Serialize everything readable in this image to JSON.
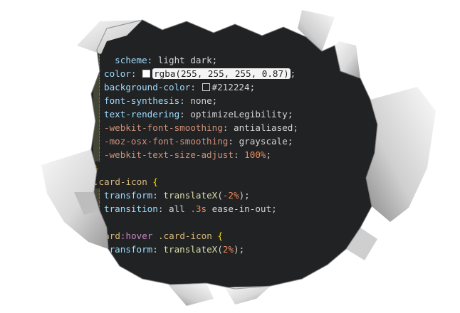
{
  "colors": {
    "editor_bg": "#212224",
    "paper": "#ffffff",
    "property": "#9cdcfe",
    "value": "#d4d4d4",
    "punct": "#d4d4d4",
    "number": "#b5cea8",
    "unit": "#f08a5d",
    "selector": "#d7ba7d",
    "func": "#dcdcaa",
    "keyword": "#569cd6",
    "pseudo": "#c586c0",
    "brace": "#ffd700",
    "vendor": "#ce9178"
  },
  "code": [
    {
      "indent": 1,
      "tokens": [
        {
          "t": "  scheme",
          "c": "property"
        },
        {
          "t": ": ",
          "c": "punct"
        },
        {
          "t": "light dark",
          "c": "value"
        },
        {
          "t": ";",
          "c": "punct"
        }
      ]
    },
    {
      "indent": 1,
      "tokens": [
        {
          "t": "color",
          "c": "property"
        },
        {
          "t": ": ",
          "c": "punct"
        },
        {
          "t": "",
          "c": "swatch",
          "swatch": "#ffffff"
        },
        {
          "t": "rgba(255, 255, 255, 0.87)",
          "c": "highlight"
        },
        {
          "t": ";",
          "c": "punct"
        }
      ]
    },
    {
      "indent": 1,
      "tokens": [
        {
          "t": "background-color",
          "c": "property"
        },
        {
          "t": ": ",
          "c": "punct"
        },
        {
          "t": "",
          "c": "swatch",
          "swatch": "#212224"
        },
        {
          "t": "#212224",
          "c": "value"
        },
        {
          "t": ";",
          "c": "punct"
        }
      ]
    },
    {
      "indent": 1,
      "tokens": [
        {
          "t": "font-synthesis",
          "c": "property"
        },
        {
          "t": ": ",
          "c": "punct"
        },
        {
          "t": "none",
          "c": "value"
        },
        {
          "t": ";",
          "c": "punct"
        }
      ]
    },
    {
      "indent": 1,
      "tokens": [
        {
          "t": "text-rendering",
          "c": "property"
        },
        {
          "t": ": ",
          "c": "punct"
        },
        {
          "t": "optimizeLegibility",
          "c": "value"
        },
        {
          "t": ";",
          "c": "punct"
        }
      ]
    },
    {
      "indent": 1,
      "tokens": [
        {
          "t": "-webkit-font-smoothing",
          "c": "vendor"
        },
        {
          "t": ": ",
          "c": "punct"
        },
        {
          "t": "antialiased",
          "c": "value"
        },
        {
          "t": ";",
          "c": "punct"
        }
      ]
    },
    {
      "indent": 1,
      "tokens": [
        {
          "t": "-moz-osx-font-smoothing",
          "c": "vendor"
        },
        {
          "t": ": ",
          "c": "punct"
        },
        {
          "t": "grayscale",
          "c": "value"
        },
        {
          "t": ";",
          "c": "punct"
        }
      ]
    },
    {
      "indent": 1,
      "tokens": [
        {
          "t": "-webkit-text-size-adjust",
          "c": "vendor"
        },
        {
          "t": ": ",
          "c": "punct"
        },
        {
          "t": "100%",
          "c": "unit"
        },
        {
          "t": ";",
          "c": "punct"
        }
      ]
    },
    {
      "indent": 0,
      "tokens": [
        {
          "t": "}",
          "c": "brace"
        }
      ]
    },
    {
      "indent": 0,
      "tokens": [
        {
          "t": ".card-icon",
          "c": "selector"
        },
        {
          "t": " ",
          "c": "punct"
        },
        {
          "t": "{",
          "c": "brace"
        }
      ]
    },
    {
      "indent": 1,
      "tokens": [
        {
          "t": "transform",
          "c": "property"
        },
        {
          "t": ": ",
          "c": "punct"
        },
        {
          "t": "translateX",
          "c": "func"
        },
        {
          "t": "(",
          "c": "punct"
        },
        {
          "t": "-2%",
          "c": "unit"
        },
        {
          "t": ");",
          "c": "punct"
        }
      ]
    },
    {
      "indent": 1,
      "tokens": [
        {
          "t": "transition",
          "c": "property"
        },
        {
          "t": ": ",
          "c": "punct"
        },
        {
          "t": "all ",
          "c": "value"
        },
        {
          "t": ".3s",
          "c": "unit"
        },
        {
          "t": " ease-in-out",
          "c": "value"
        },
        {
          "t": ";",
          "c": "punct"
        }
      ]
    },
    {
      "indent": 0,
      "tokens": []
    },
    {
      "indent": 0,
      "tokens": [
        {
          "t": ".card",
          "c": "selector"
        },
        {
          "t": ":hover",
          "c": "pseudo"
        },
        {
          "t": " ",
          "c": "punct"
        },
        {
          "t": ".card-icon",
          "c": "selector"
        },
        {
          "t": " ",
          "c": "punct"
        },
        {
          "t": "{",
          "c": "brace"
        }
      ]
    },
    {
      "indent": 1,
      "tokens": [
        {
          "t": "transform",
          "c": "property"
        },
        {
          "t": ": ",
          "c": "punct"
        },
        {
          "t": "translateX",
          "c": "func"
        },
        {
          "t": "(",
          "c": "punct"
        },
        {
          "t": "2%",
          "c": "unit"
        },
        {
          "t": ");",
          "c": "punct"
        }
      ]
    }
  ]
}
